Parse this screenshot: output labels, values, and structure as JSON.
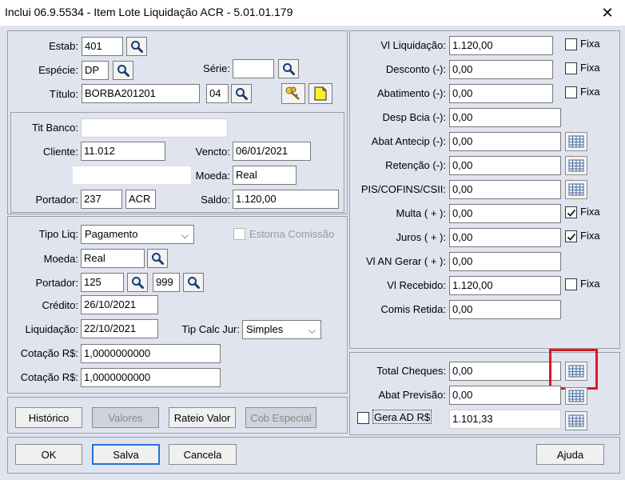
{
  "window": {
    "title": "Inclui 06.9.5534 - Item Lote Liquidação ACR - 5.01.01.179",
    "close_label": "✕"
  },
  "left_top": {
    "estab_label": "Estab:",
    "estab_value": "401",
    "especie_label": "Espécie:",
    "especie_value": "DP",
    "serie_label": "Série:",
    "serie_value": "",
    "titulo_label": "Título:",
    "titulo_value": "BORBA201201",
    "parcela_value": "04"
  },
  "left_info": {
    "tit_banco_label": "Tit Banco:",
    "tit_banco_value": "",
    "cliente_label": "Cliente:",
    "cliente_value": "11.012",
    "vencto_label": "Vencto:",
    "vencto_value": "06/01/2021",
    "nome_value": "",
    "moeda_label": "Moeda:",
    "moeda_value": "Real",
    "portador_label": "Portador:",
    "portador_value": "237",
    "portador_cart": "ACR",
    "saldo_label": "Saldo:",
    "saldo_value": "1.120,00"
  },
  "left_payment": {
    "tipo_liq_label": "Tipo Liq:",
    "tipo_liq_value": "Pagamento",
    "estorna_label": "Estorna Comissão",
    "moeda_label": "Moeda:",
    "moeda_value": "Real",
    "portador_label": "Portador:",
    "portador_value": "125",
    "carteira_value": "999",
    "credito_label": "Crédito:",
    "credito_value": "26/10/2021",
    "liquidacao_label": "Liquidação:",
    "liquidacao_value": "22/10/2021",
    "tip_calc_label": "Tip Calc Jur:",
    "tip_calc_value": "Simples",
    "cotacao1_label": "Cotação R$:",
    "cotacao1_value": "1,0000000000",
    "cotacao2_label": "Cotação R$:",
    "cotacao2_value": "1,0000000000"
  },
  "left_buttons": {
    "historico": "Histórico",
    "valores": "Valores",
    "rateio": "Rateio Valor",
    "cob_especial": "Cob Especial"
  },
  "right_values": {
    "fixa_label": "Fixa",
    "rows": [
      {
        "label": "Vl Liquidação:",
        "value": "1.120,00"
      },
      {
        "label": "Desconto (-):",
        "value": "0,00"
      },
      {
        "label": "Abatimento (-):",
        "value": "0,00"
      },
      {
        "label": "Desp Bcia (-):",
        "value": "0,00"
      },
      {
        "label": "Abat Antecip (-):",
        "value": "0,00"
      },
      {
        "label": "Retenção (-):",
        "value": "0,00"
      },
      {
        "label": "PIS/COFINS/CSII:",
        "value": "0,00"
      },
      {
        "label": "Multa ( + ):",
        "value": "0,00"
      },
      {
        "label": "Juros ( + ):",
        "value": "0,00"
      },
      {
        "label": "Vl AN Gerar ( + ):",
        "value": "0,00"
      },
      {
        "label": "Vl Recebido:",
        "value": "1.120,00"
      },
      {
        "label": "Comis Retida:",
        "value": "0,00"
      }
    ]
  },
  "right_bottom": {
    "total_cheques_label": "Total Cheques:",
    "total_cheques_value": "0,00",
    "abat_previsao_label": "Abat Previsão:",
    "abat_previsao_value": "0,00",
    "gera_ad_label": "Gera AD R$",
    "gera_ad_value": "1.101,33"
  },
  "footer": {
    "ok": "OK",
    "salva": "Salva",
    "cancela": "Cancela",
    "ajuda": "Ajuda"
  },
  "colors": {
    "background": "#dfe4ee",
    "highlight": "#e0171f",
    "default_button_border": "#2a6fd6"
  }
}
